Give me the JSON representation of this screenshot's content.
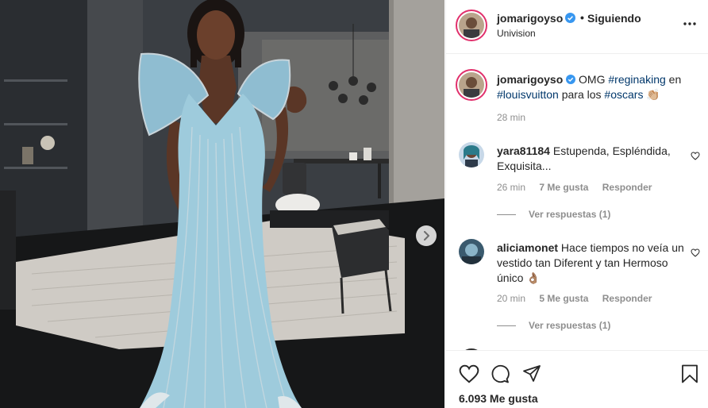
{
  "post": {
    "username": "jomarigoyso",
    "separator": "•",
    "follow_status": "Siguiendo",
    "location": "Univision"
  },
  "caption": {
    "username": "jomarigoyso",
    "text_1": "OMG",
    "tag_1": "#reginaking",
    "text_2": "en",
    "tag_2": "#louisvuitton",
    "text_3": "para los",
    "tag_3": "#oscars",
    "emoji": "👏🏼",
    "time": "28 min"
  },
  "comments": [
    {
      "username": "yara81184",
      "text": "Estupenda, Espléndida, Exquisita...",
      "time": "26 min",
      "likes": "7 Me gusta",
      "reply": "Responder",
      "view_replies": "Ver respuestas (1)"
    },
    {
      "username": "aliciamonet",
      "text": "Hace tiempos no veía un vestido tan Diferent y tan Hermoso único 👌🏽",
      "time": "20 min",
      "likes": "5 Me gusta",
      "reply": "Responder",
      "view_replies": "Ver respuestas (1)"
    }
  ],
  "actions": {
    "like_icon": "heart-icon",
    "comment_icon": "comment-icon",
    "share_icon": "paper-plane-icon",
    "save_icon": "bookmark-icon"
  },
  "likes_count": "6.093 Me gusta",
  "colors": {
    "verified_blue": "#3897f0",
    "hashtag": "#00376b",
    "meta_gray": "#8e8e8e",
    "dress_blue": "#9ecbdc"
  }
}
